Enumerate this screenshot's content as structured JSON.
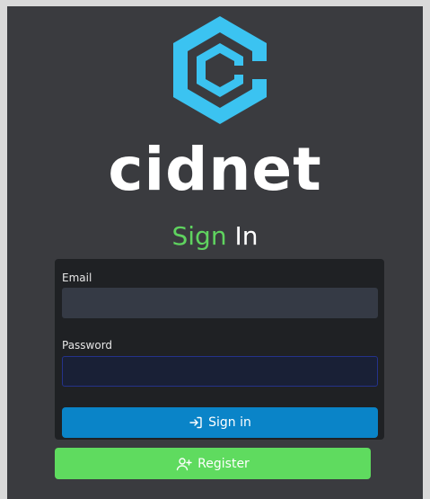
{
  "brand": {
    "wordmark": "cidnet",
    "logo_icon": "hexagon-c-logo",
    "logo_color": "#3bc3f1"
  },
  "title": {
    "accent": "Sign",
    "rest": " In"
  },
  "form": {
    "email_label": "Email",
    "email_value": "",
    "password_label": "Password",
    "password_value": ""
  },
  "buttons": {
    "signin_label": "Sign in",
    "signin_icon": "sign-in-arrow-icon",
    "register_label": "Register",
    "register_icon": "user-plus-icon"
  },
  "colors": {
    "accent_green": "#5fd35f",
    "signin_blue": "#0a84c8",
    "register_green": "#5fdb5f"
  }
}
